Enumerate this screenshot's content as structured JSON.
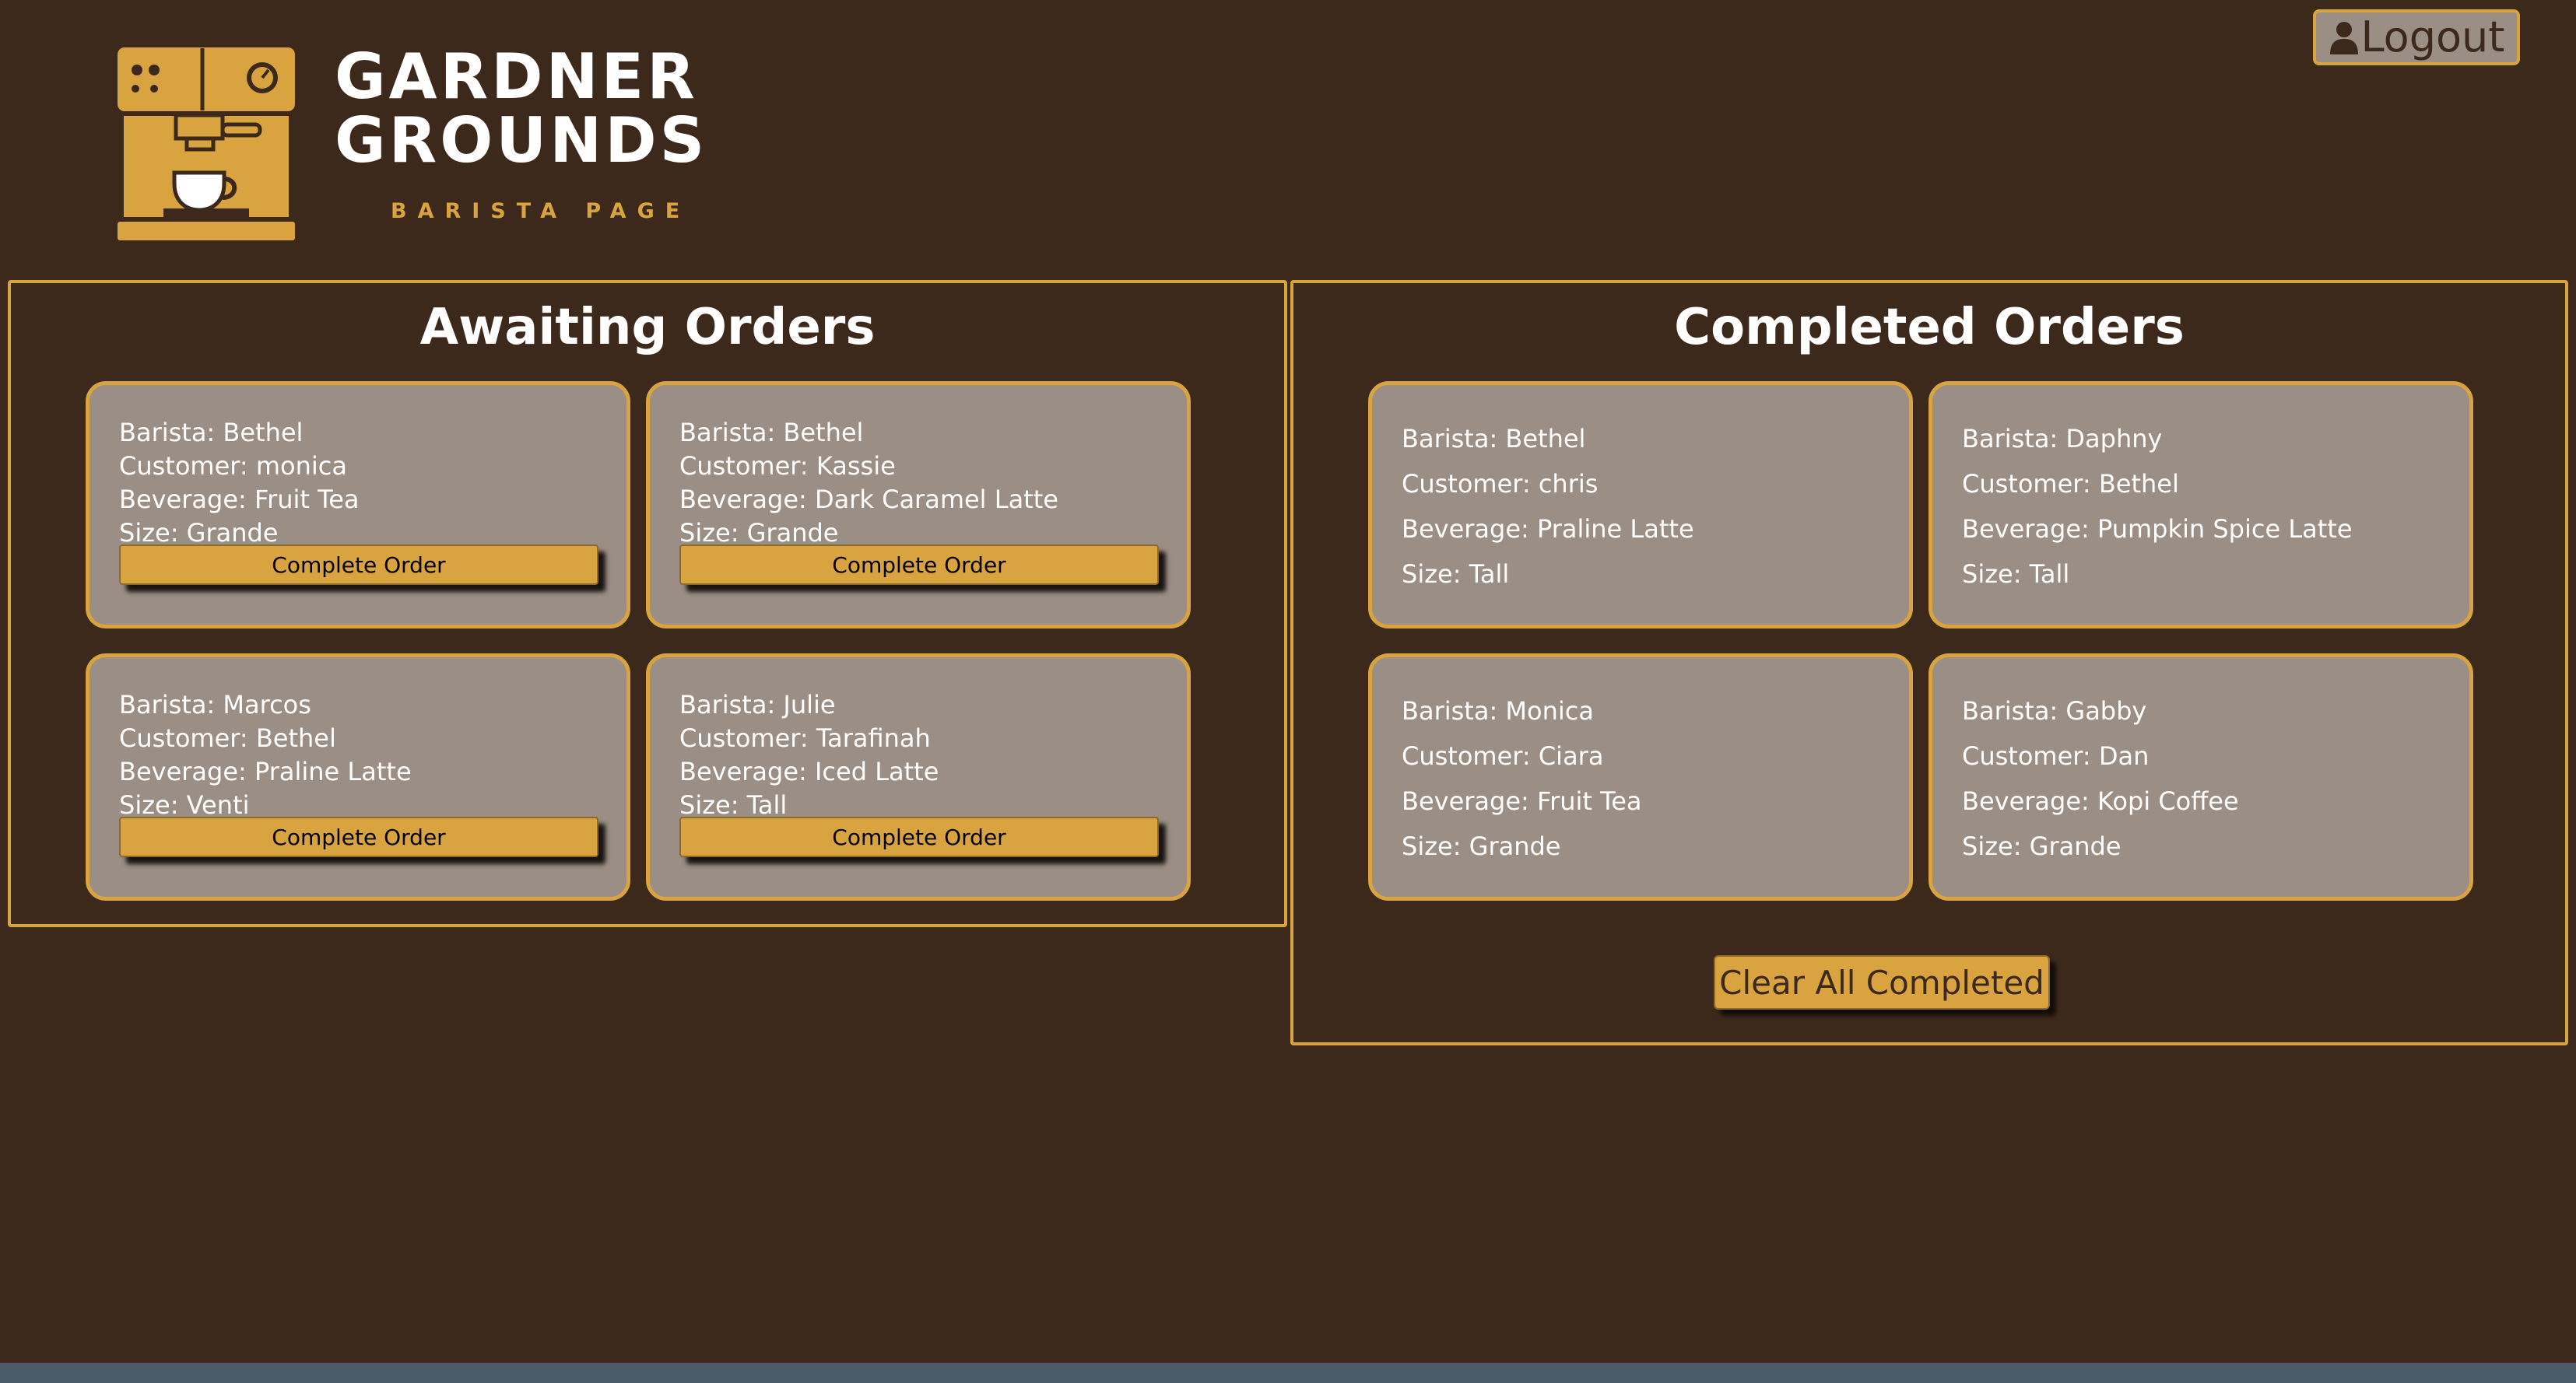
{
  "header": {
    "brand_line1": "GARDNER",
    "brand_line2": "GROUNDS",
    "subtitle": "BARISTA PAGE",
    "logout_label": "Logout",
    "logout_icon": "user-icon",
    "logo_icon": "espresso-machine-icon"
  },
  "awaiting": {
    "title": "Awaiting Orders",
    "button_label": "Complete Order",
    "orders": [
      {
        "barista": "Barista: Bethel",
        "customer": "Customer: monica",
        "beverage": "Beverage: Fruit Tea",
        "size": "Size: Grande"
      },
      {
        "barista": "Barista: Bethel",
        "customer": "Customer: Kassie",
        "beverage": "Beverage: Dark Caramel Latte",
        "size": "Size: Grande"
      },
      {
        "barista": "Barista: Marcos",
        "customer": "Customer: Bethel",
        "beverage": "Beverage: Praline Latte",
        "size": "Size: Venti"
      },
      {
        "barista": "Barista: Julie",
        "customer": "Customer: Tarafinah",
        "beverage": "Beverage: Iced Latte",
        "size": "Size: Tall"
      }
    ]
  },
  "completed": {
    "title": "Completed Orders",
    "clear_label": "Clear All Completed",
    "orders": [
      {
        "barista": "Barista: Bethel",
        "customer": "Customer: chris",
        "beverage": "Beverage: Praline Latte",
        "size": "Size: Tall"
      },
      {
        "barista": "Barista: Daphny",
        "customer": "Customer: Bethel",
        "beverage": "Beverage: Pumpkin Spice Latte",
        "size": "Size: Tall"
      },
      {
        "barista": "Barista: Monica",
        "customer": "Customer: Ciara",
        "beverage": "Beverage: Fruit Tea",
        "size": "Size: Grande"
      },
      {
        "barista": "Barista: Gabby",
        "customer": "Customer: Dan",
        "beverage": "Beverage: Kopi Coffee",
        "size": "Size: Grande"
      }
    ]
  },
  "colors": {
    "background": "#3d291c",
    "accent": "#d9a440",
    "card": "#9b8e84",
    "text": "#ffffff"
  }
}
